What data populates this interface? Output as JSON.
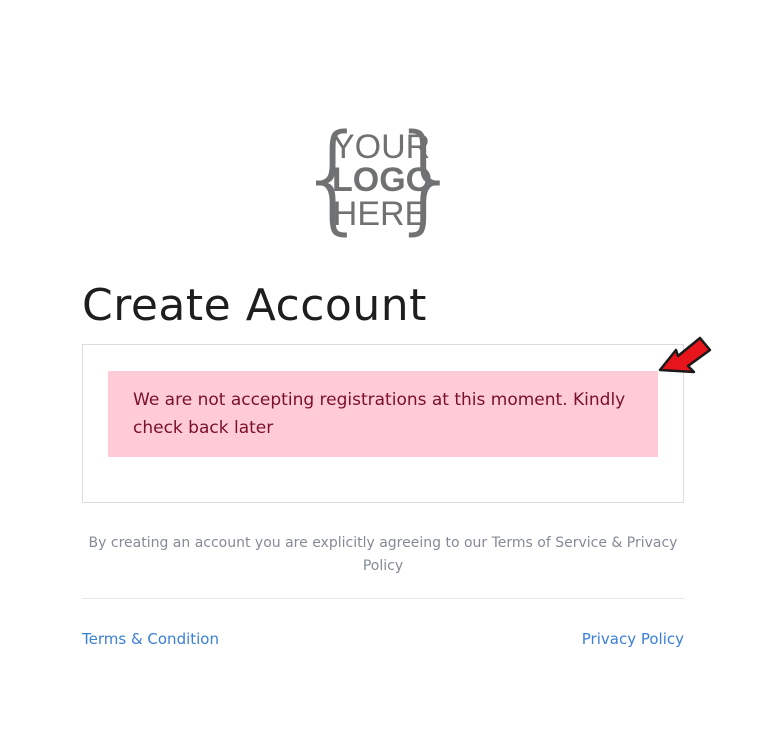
{
  "logo": {
    "line1": "YOUR",
    "line2": "LOGO",
    "line3": "HERE",
    "left_brace": "{",
    "right_brace": "}"
  },
  "page": {
    "title": "Create Account"
  },
  "alert": {
    "message": "We are not accepting registrations at this moment. Kindly check back later",
    "background_color": "#fecbd6",
    "text_color": "#7a0f2a"
  },
  "annotation": {
    "icon": "red-arrow-icon",
    "color": "#e8141c"
  },
  "agreement": {
    "text": "By creating an account you are explicitly agreeing to our Terms of Service & Privacy Policy"
  },
  "footer": {
    "terms_link": "Terms & Condition",
    "privacy_link": "Privacy Policy",
    "link_color": "#3a7fd6"
  }
}
